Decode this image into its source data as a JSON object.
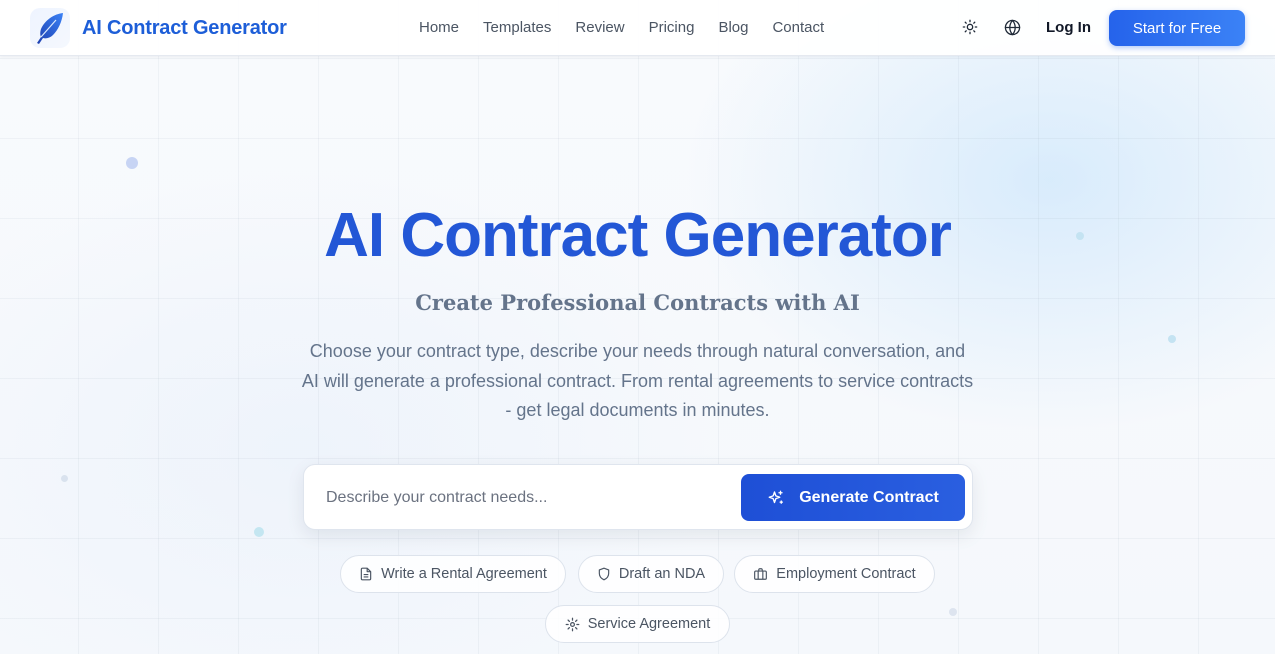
{
  "brand": {
    "name": "AI Contract Generator",
    "logo_icon": "feather-icon",
    "color": "#1d5ed8"
  },
  "nav": {
    "items": [
      "Home",
      "Templates",
      "Review",
      "Pricing",
      "Blog",
      "Contact"
    ]
  },
  "header": {
    "theme_icon": "sun-icon",
    "language_icon": "globe-icon",
    "login_label": "Log In",
    "cta_label": "Start for Free"
  },
  "hero": {
    "title": "AI Contract Generator",
    "subtitle": "Create Professional Contracts with AI",
    "description": "Choose your contract type, describe your needs through natural conversation, and AI will generate a professional contract. From rental agreements to service contracts - get legal documents in minutes."
  },
  "search": {
    "placeholder": "Describe your contract needs...",
    "value": "",
    "button_label": "Generate Contract",
    "button_icon": "sparkles-icon"
  },
  "suggestions": [
    {
      "label": "Write a Rental Agreement",
      "icon": "document-icon"
    },
    {
      "label": "Draft an NDA",
      "icon": "shield-icon"
    },
    {
      "label": "Employment Contract",
      "icon": "briefcase-icon"
    },
    {
      "label": "Service Agreement",
      "icon": "gear-icon"
    }
  ],
  "colors": {
    "accent": "#2357d6",
    "button": "#2563eb",
    "text_muted": "#64748b"
  }
}
